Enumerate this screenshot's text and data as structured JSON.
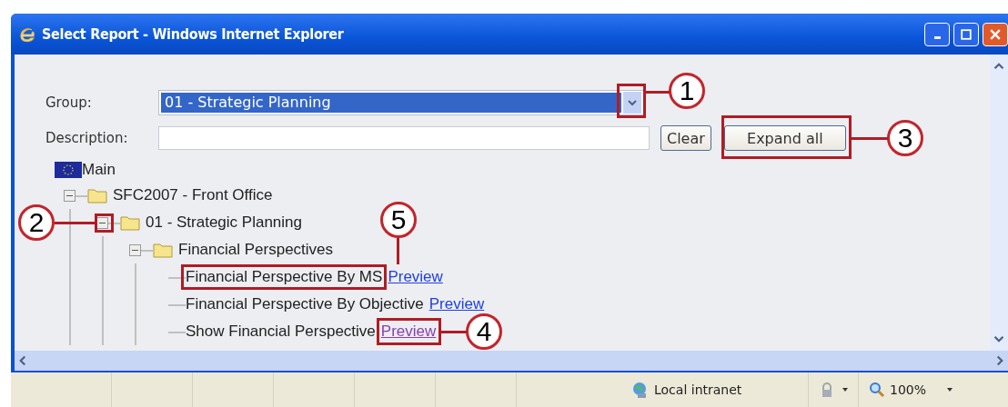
{
  "window": {
    "title": "Select Report - Windows Internet Explorer"
  },
  "form": {
    "group_label": "Group:",
    "group_value": "01 - Strategic Planning",
    "description_label": "Description:",
    "clear_button": "Clear",
    "expand_button": "Expand all"
  },
  "tree": {
    "label": "Main",
    "children": [
      {
        "label": "SFC2007 - Front Office",
        "expanded": true,
        "children": [
          {
            "label": "01 - Strategic Planning",
            "expanded": true,
            "children": [
              {
                "label": "Financial Perspectives",
                "expanded": true,
                "children": [
                  {
                    "label": "Financial Perspective By MS",
                    "link": "Preview",
                    "visited": false
                  },
                  {
                    "label": "Financial Perspective By Objective",
                    "link": "Preview",
                    "visited": false
                  },
                  {
                    "label": "Show Financial Perspective",
                    "link": "Preview",
                    "visited": true
                  }
                ]
              }
            ]
          }
        ]
      }
    ]
  },
  "callouts": [
    {
      "number": "1"
    },
    {
      "number": "2"
    },
    {
      "number": "3"
    },
    {
      "number": "4"
    },
    {
      "number": "5"
    }
  ],
  "status_bar": {
    "zone": "Local intranet",
    "zoom": "100%"
  }
}
